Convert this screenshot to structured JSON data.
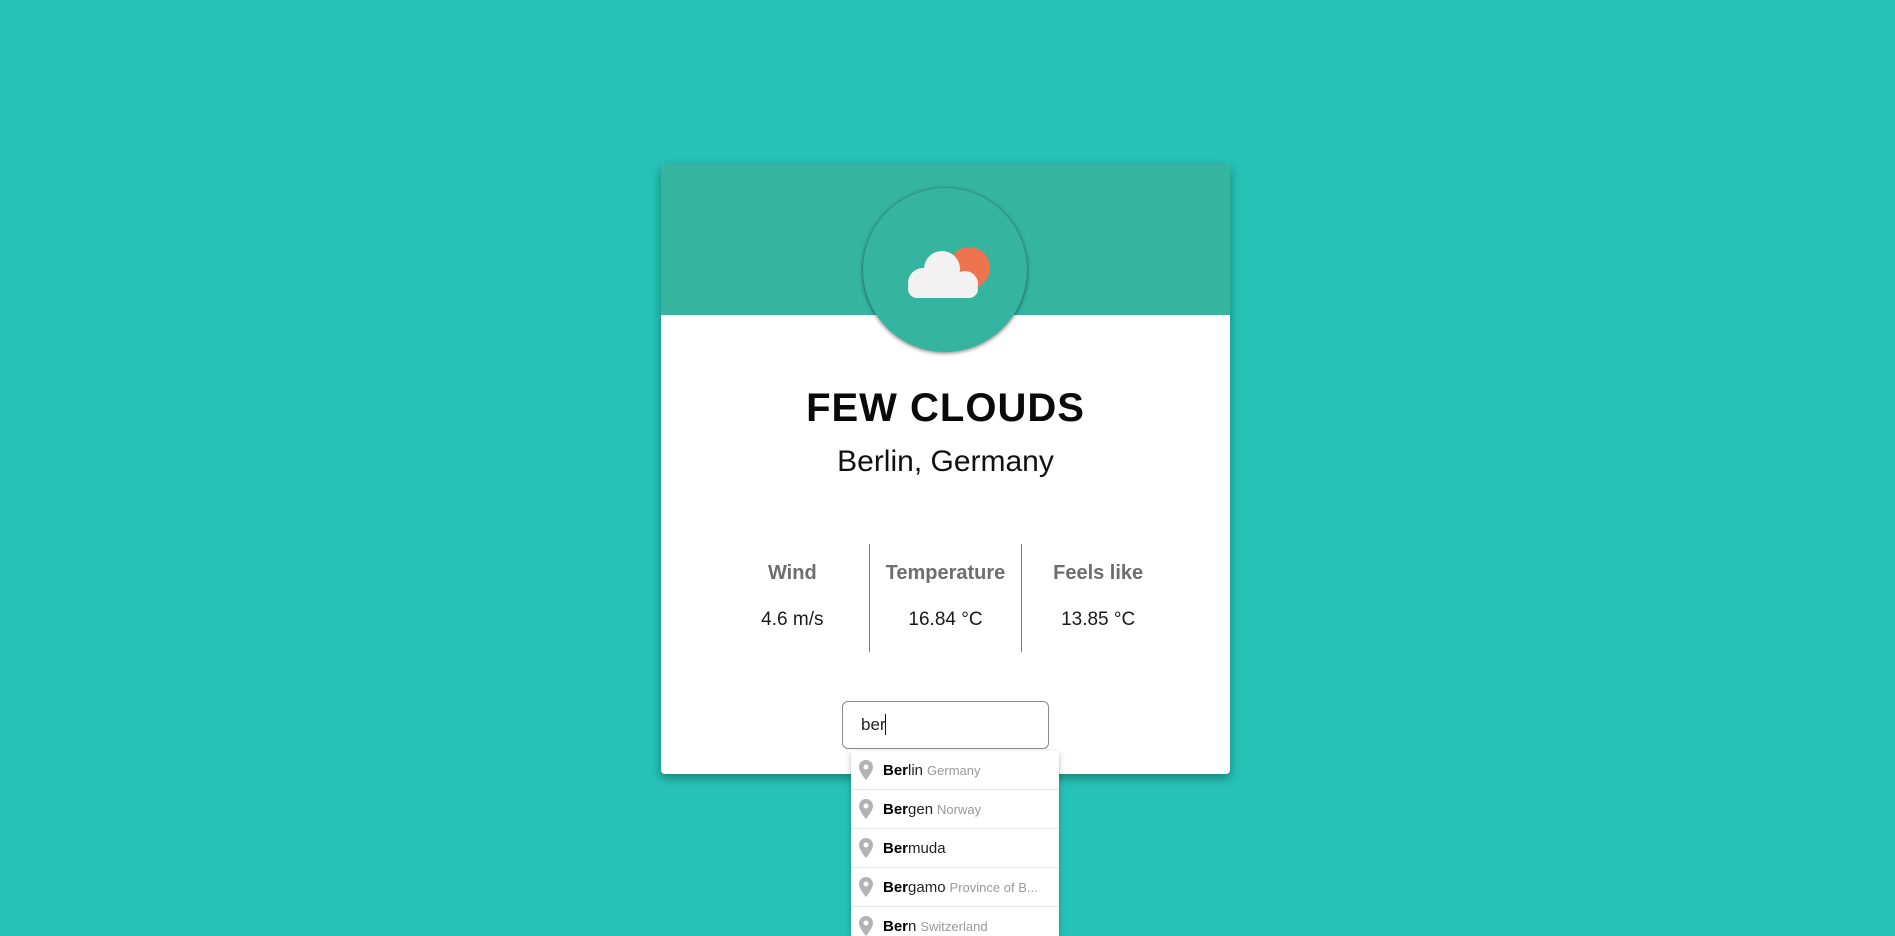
{
  "weather": {
    "description": "FEW CLOUDS",
    "location": "Berlin, Germany",
    "icon": "few-clouds-icon"
  },
  "stats": [
    {
      "label": "Wind",
      "value": "4.6 m/s"
    },
    {
      "label": "Temperature",
      "value": "16.84 °C"
    },
    {
      "label": "Feels like",
      "value": "13.85 °C"
    }
  ],
  "search": {
    "value": "ber"
  },
  "suggestions": [
    {
      "match": "Ber",
      "rest": "lin",
      "secondary": "Germany"
    },
    {
      "match": "Ber",
      "rest": "gen",
      "secondary": "Norway"
    },
    {
      "match": "Ber",
      "rest": "muda",
      "secondary": ""
    },
    {
      "match": "Ber",
      "rest": "gamo",
      "secondary": "Province of B..."
    },
    {
      "match": "Ber",
      "rest": "n",
      "secondary": "Switzerland"
    }
  ],
  "colors": {
    "background": "#27c2b6",
    "header": "#35b49f",
    "sun": "#f07350",
    "cloud": "#f2f2f2"
  }
}
